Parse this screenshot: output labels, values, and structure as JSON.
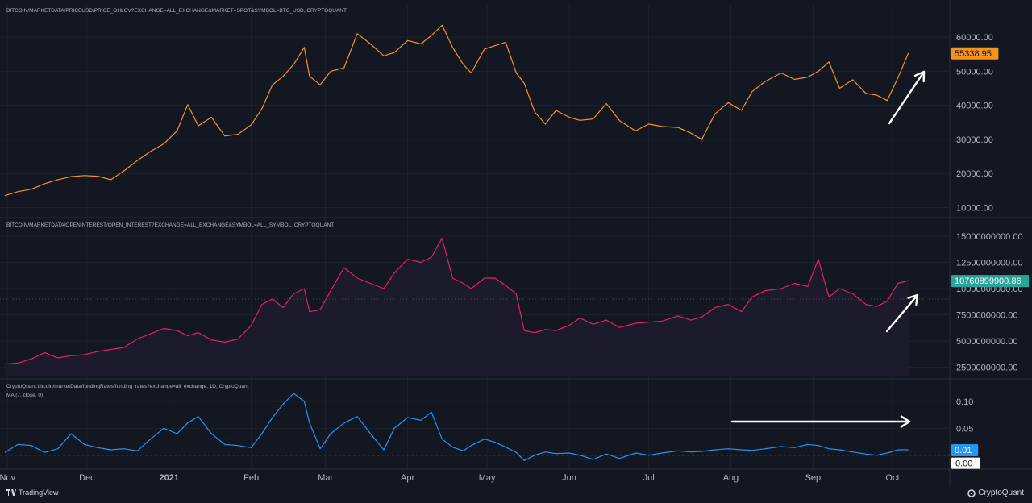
{
  "chart_data": [
    {
      "type": "line",
      "title": "BITCOIN/MARKETDATA/PRICEUSD/PRICE_OHLCV?EXCHANGE=ALL_EXCHANGE&MARKET=SPOT&SYMBOL=BTC_USD, CRYPTOQUANT",
      "color": "#f7931a",
      "ylim": [
        8000,
        69000
      ],
      "yticks": [
        "60000.00",
        "50000.00",
        "40000.00",
        "30000.00",
        "20000.00",
        "10000.00"
      ],
      "ytick_values": [
        60000,
        50000,
        40000,
        30000,
        20000,
        10000
      ],
      "last_value_label": "55338.95",
      "last_value": 55338.95,
      "x": [
        "2020-10-31",
        "2020-11-05",
        "2020-11-10",
        "2020-11-15",
        "2020-11-20",
        "2020-11-25",
        "2020-11-30",
        "2020-12-05",
        "2020-12-10",
        "2020-12-15",
        "2020-12-20",
        "2020-12-25",
        "2020-12-30",
        "2021-01-04",
        "2021-01-08",
        "2021-01-12",
        "2021-01-17",
        "2021-01-22",
        "2021-01-27",
        "2021-02-01",
        "2021-02-05",
        "2021-02-09",
        "2021-02-13",
        "2021-02-17",
        "2021-02-21",
        "2021-02-23",
        "2021-02-27",
        "2021-03-03",
        "2021-03-08",
        "2021-03-13",
        "2021-03-18",
        "2021-03-23",
        "2021-03-27",
        "2021-04-01",
        "2021-04-06",
        "2021-04-10",
        "2021-04-14",
        "2021-04-18",
        "2021-04-22",
        "2021-04-25",
        "2021-04-30",
        "2021-05-04",
        "2021-05-08",
        "2021-05-12",
        "2021-05-15",
        "2021-05-19",
        "2021-05-23",
        "2021-05-27",
        "2021-06-01",
        "2021-06-05",
        "2021-06-10",
        "2021-06-15",
        "2021-06-20",
        "2021-06-26",
        "2021-07-01",
        "2021-07-06",
        "2021-07-12",
        "2021-07-17",
        "2021-07-21",
        "2021-07-26",
        "2021-07-31",
        "2021-08-05",
        "2021-08-09",
        "2021-08-14",
        "2021-08-20",
        "2021-08-25",
        "2021-08-30",
        "2021-09-03",
        "2021-09-07",
        "2021-09-11",
        "2021-09-16",
        "2021-09-21",
        "2021-09-25",
        "2021-09-29",
        "2021-10-03",
        "2021-10-07"
      ],
      "values": [
        13500,
        14700,
        15400,
        17000,
        18200,
        19100,
        19400,
        19200,
        18200,
        20800,
        23800,
        26500,
        28700,
        32500,
        40200,
        34000,
        36500,
        31000,
        31500,
        34300,
        39000,
        46000,
        48500,
        52000,
        57000,
        48500,
        46000,
        50000,
        51000,
        61000,
        58000,
        54500,
        55500,
        59000,
        58000,
        60500,
        63500,
        57000,
        52000,
        49500,
        56500,
        57500,
        58500,
        49500,
        46500,
        38000,
        34500,
        38500,
        36500,
        35600,
        36000,
        40500,
        35500,
        32500,
        34500,
        33800,
        33500,
        31800,
        30000,
        37500,
        40800,
        38500,
        44000,
        47000,
        49500,
        47600,
        48300,
        50000,
        52700,
        45000,
        47500,
        43500,
        43000,
        41400,
        48000,
        55338.95
      ]
    },
    {
      "type": "area",
      "title": "BITCOIN/MARKETDATA/OPENINTEREST/OPEN_INTEREST?EXCHANGE=ALL_EXCHANGE&SYMBOL=ALL_SYMBOL, CRYPTOQUANT",
      "color": "#e91e63",
      "ylim": [
        1700000000,
        16000000000
      ],
      "yticks": [
        "15000000000.00",
        "12500000000.00",
        "10000000000.00",
        "7500000000.00",
        "5000000000.00",
        "2500000000.00"
      ],
      "ytick_values": [
        15000000000,
        12500000000,
        10000000000,
        7500000000,
        5000000000,
        2500000000
      ],
      "last_value_label": "10760899900.86",
      "last_value": 10760899900.86,
      "x": [
        "2020-10-31",
        "2020-11-05",
        "2020-11-10",
        "2020-11-15",
        "2020-11-20",
        "2020-11-25",
        "2020-11-30",
        "2020-12-05",
        "2020-12-10",
        "2020-12-15",
        "2020-12-20",
        "2020-12-25",
        "2020-12-30",
        "2021-01-04",
        "2021-01-08",
        "2021-01-12",
        "2021-01-17",
        "2021-01-22",
        "2021-01-27",
        "2021-02-01",
        "2021-02-05",
        "2021-02-09",
        "2021-02-13",
        "2021-02-17",
        "2021-02-21",
        "2021-02-23",
        "2021-02-27",
        "2021-03-03",
        "2021-03-08",
        "2021-03-13",
        "2021-03-18",
        "2021-03-23",
        "2021-03-27",
        "2021-04-01",
        "2021-04-06",
        "2021-04-10",
        "2021-04-14",
        "2021-04-18",
        "2021-04-22",
        "2021-04-25",
        "2021-04-30",
        "2021-05-04",
        "2021-05-08",
        "2021-05-12",
        "2021-05-15",
        "2021-05-19",
        "2021-05-23",
        "2021-05-27",
        "2021-06-01",
        "2021-06-05",
        "2021-06-10",
        "2021-06-15",
        "2021-06-20",
        "2021-06-26",
        "2021-07-01",
        "2021-07-06",
        "2021-07-12",
        "2021-07-17",
        "2021-07-21",
        "2021-07-26",
        "2021-07-31",
        "2021-08-05",
        "2021-08-09",
        "2021-08-14",
        "2021-08-20",
        "2021-08-25",
        "2021-08-30",
        "2021-09-03",
        "2021-09-07",
        "2021-09-11",
        "2021-09-16",
        "2021-09-21",
        "2021-09-25",
        "2021-09-29",
        "2021-10-03",
        "2021-10-07"
      ],
      "values": [
        2800000000,
        2900000000,
        3300000000,
        3900000000,
        3400000000,
        3600000000,
        3700000000,
        4000000000,
        4200000000,
        4400000000,
        5200000000,
        5700000000,
        6200000000,
        6000000000,
        5500000000,
        5800000000,
        5100000000,
        4900000000,
        5200000000,
        6500000000,
        8500000000,
        9000000000,
        8200000000,
        9500000000,
        10000000000,
        7800000000,
        8000000000,
        9800000000,
        12000000000,
        11000000000,
        10500000000,
        10000000000,
        11500000000,
        12800000000,
        12500000000,
        13000000000,
        14800000000,
        11000000000,
        10500000000,
        10000000000,
        11000000000,
        11000000000,
        10300000000,
        9500000000,
        6000000000,
        5800000000,
        6100000000,
        6000000000,
        6500000000,
        7200000000,
        6600000000,
        7000000000,
        6300000000,
        6700000000,
        6800000000,
        6900000000,
        7400000000,
        7000000000,
        7300000000,
        8200000000,
        8500000000,
        7800000000,
        9200000000,
        9800000000,
        10000000000,
        10500000000,
        10200000000,
        12800000000,
        9200000000,
        10000000000,
        9500000000,
        8500000000,
        8300000000,
        8800000000,
        10500000000,
        10760899900.86
      ]
    },
    {
      "type": "line",
      "title": "CryptoQuant:bitcoin/marketData/fundingRates/funding_rates?exchange=all_exchange, 1D, CryptoQuant",
      "subtitle": "MA (7, close, 0)",
      "color": "#2196f3",
      "ylim": [
        -0.02,
        0.13
      ],
      "yticks": [
        "0.10",
        "0.05"
      ],
      "ytick_values": [
        0.1,
        0.05
      ],
      "last_value_label": "0.01",
      "last_value": 0.01,
      "zero_label": "0.00",
      "x": [
        "2020-10-31",
        "2020-11-05",
        "2020-11-10",
        "2020-11-15",
        "2020-11-20",
        "2020-11-25",
        "2020-11-30",
        "2020-12-05",
        "2020-12-10",
        "2020-12-15",
        "2020-12-20",
        "2020-12-25",
        "2020-12-30",
        "2021-01-04",
        "2021-01-08",
        "2021-01-12",
        "2021-01-17",
        "2021-01-22",
        "2021-01-27",
        "2021-02-01",
        "2021-02-05",
        "2021-02-09",
        "2021-02-13",
        "2021-02-17",
        "2021-02-21",
        "2021-02-23",
        "2021-02-27",
        "2021-03-03",
        "2021-03-08",
        "2021-03-13",
        "2021-03-18",
        "2021-03-23",
        "2021-03-27",
        "2021-04-01",
        "2021-04-06",
        "2021-04-10",
        "2021-04-14",
        "2021-04-18",
        "2021-04-22",
        "2021-04-25",
        "2021-04-30",
        "2021-05-04",
        "2021-05-08",
        "2021-05-12",
        "2021-05-15",
        "2021-05-19",
        "2021-05-23",
        "2021-05-27",
        "2021-06-01",
        "2021-06-05",
        "2021-06-10",
        "2021-06-15",
        "2021-06-20",
        "2021-06-26",
        "2021-07-01",
        "2021-07-06",
        "2021-07-12",
        "2021-07-17",
        "2021-07-21",
        "2021-07-26",
        "2021-07-31",
        "2021-08-05",
        "2021-08-09",
        "2021-08-14",
        "2021-08-20",
        "2021-08-25",
        "2021-08-30",
        "2021-09-03",
        "2021-09-07",
        "2021-09-11",
        "2021-09-16",
        "2021-09-21",
        "2021-09-25",
        "2021-09-29",
        "2021-10-03",
        "2021-10-07"
      ],
      "values": [
        0.005,
        0.02,
        0.018,
        0.005,
        0.012,
        0.04,
        0.02,
        0.014,
        0.01,
        0.012,
        0.008,
        0.03,
        0.05,
        0.04,
        0.06,
        0.072,
        0.04,
        0.02,
        0.018,
        0.014,
        0.04,
        0.07,
        0.095,
        0.115,
        0.1,
        0.06,
        0.012,
        0.04,
        0.06,
        0.072,
        0.04,
        0.01,
        0.05,
        0.07,
        0.065,
        0.08,
        0.03,
        0.015,
        0.008,
        0.018,
        0.03,
        0.024,
        0.015,
        0.005,
        -0.01,
        0.0,
        0.006,
        0.003,
        0.004,
        0.0,
        -0.008,
        0.002,
        -0.006,
        0.004,
        0.0,
        0.004,
        0.008,
        0.006,
        0.007,
        0.01,
        0.012,
        0.01,
        0.009,
        0.012,
        0.016,
        0.014,
        0.02,
        0.018,
        0.012,
        0.01,
        0.006,
        0.002,
        0.0,
        0.004,
        0.01,
        0.01
      ]
    }
  ],
  "x_axis": {
    "ticks": [
      {
        "label": "Nov",
        "date": "2020-11-01"
      },
      {
        "label": "Dec",
        "date": "2020-12-01"
      },
      {
        "label": "2021",
        "date": "2021-01-01"
      },
      {
        "label": "Feb",
        "date": "2021-02-01"
      },
      {
        "label": "Mar",
        "date": "2021-03-01"
      },
      {
        "label": "Apr",
        "date": "2021-04-01"
      },
      {
        "label": "May",
        "date": "2021-05-01"
      },
      {
        "label": "Jun",
        "date": "2021-06-01"
      },
      {
        "label": "Jul",
        "date": "2021-07-01"
      },
      {
        "label": "Aug",
        "date": "2021-08-01"
      },
      {
        "label": "Sep",
        "date": "2021-09-01"
      },
      {
        "label": "Oct",
        "date": "2021-10-01"
      }
    ]
  },
  "annotations": [
    {
      "type": "arrow",
      "direction": "up-right",
      "pane": 0
    },
    {
      "type": "arrow",
      "direction": "up-right",
      "pane": 1
    },
    {
      "type": "arrow",
      "direction": "right",
      "pane": 2
    }
  ],
  "footer": {
    "left_logo": "TradingView",
    "right_logo": "CryptoQuant"
  },
  "colors": {
    "background": "#131722",
    "price": "#f7931a",
    "open_interest": "#e91e63",
    "funding": "#2196f3",
    "oi_label": "#26a69a"
  }
}
